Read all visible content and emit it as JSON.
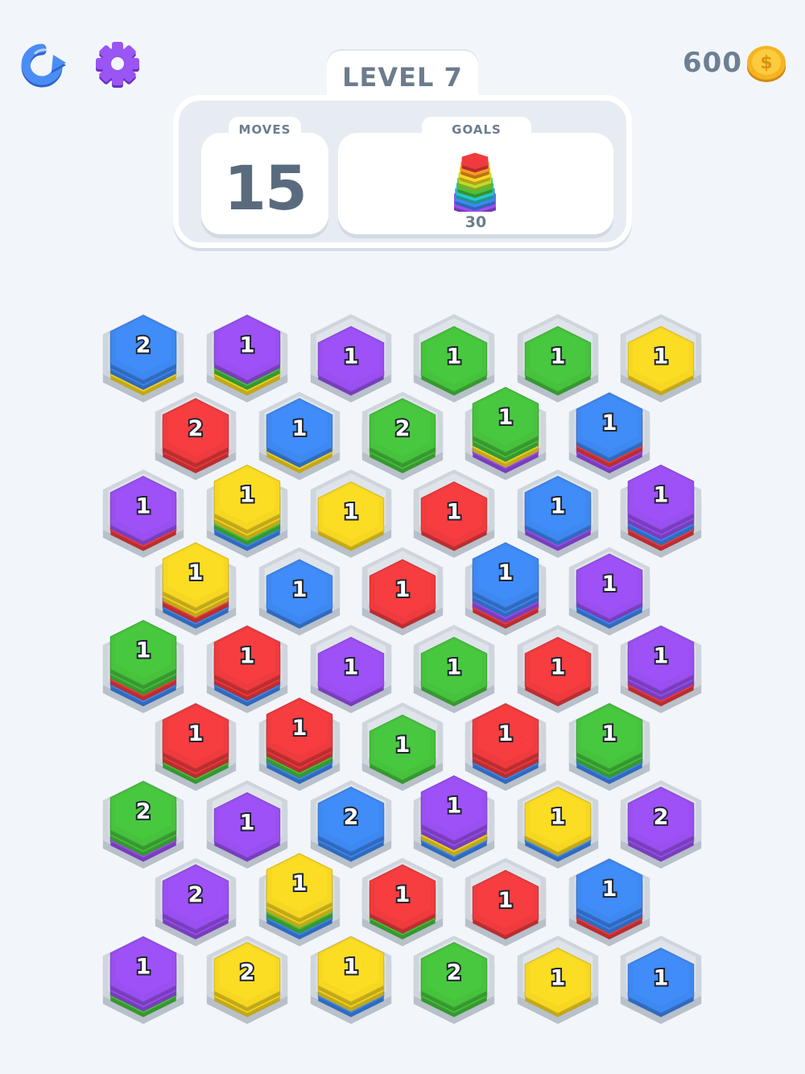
{
  "header": {
    "level_label": "LEVEL 7",
    "coins": "600",
    "restart_icon": "restart-icon",
    "settings_icon": "gear-icon",
    "coin_icon": "coin-icon"
  },
  "moves": {
    "label": "MOVES",
    "value": "15"
  },
  "goals": {
    "label": "GOALS",
    "value": "30",
    "icon": "rainbow-stack-icon"
  },
  "colors": {
    "blue": "#3e88f2",
    "purple": "#9a4ff0",
    "green": "#46c23d",
    "yellow": "#f7d722",
    "red": "#ef3b3e",
    "slot": "#cfd5dd",
    "background": "#f2f6fb"
  },
  "board": {
    "rows": [
      [
        {
          "count": "2",
          "layers": [
            "yellow",
            "blue",
            "blue"
          ]
        },
        {
          "count": "1",
          "layers": [
            "yellow",
            "green",
            "purple"
          ]
        },
        {
          "count": "1",
          "layers": [
            "purple"
          ]
        },
        {
          "count": "1",
          "layers": [
            "green"
          ]
        },
        {
          "count": "1",
          "layers": [
            "green"
          ]
        },
        {
          "count": "1",
          "layers": [
            "yellow"
          ]
        }
      ],
      [
        {
          "count": "2",
          "layers": [
            "red",
            "red"
          ]
        },
        {
          "count": "1",
          "layers": [
            "yellow",
            "blue"
          ]
        },
        {
          "count": "2",
          "layers": [
            "green",
            "green"
          ]
        },
        {
          "count": "1",
          "layers": [
            "purple",
            "yellow",
            "green",
            "green"
          ]
        },
        {
          "count": "1",
          "layers": [
            "purple",
            "red",
            "blue"
          ]
        }
      ],
      [
        {
          "count": "1",
          "layers": [
            "red",
            "purple"
          ]
        },
        {
          "count": "1",
          "layers": [
            "blue",
            "green",
            "yellow",
            "yellow"
          ]
        },
        {
          "count": "1",
          "layers": [
            "yellow"
          ]
        },
        {
          "count": "1",
          "layers": [
            "red"
          ]
        },
        {
          "count": "1",
          "layers": [
            "purple",
            "blue"
          ]
        },
        {
          "count": "1",
          "layers": [
            "red",
            "blue",
            "purple",
            "purple"
          ]
        }
      ],
      [
        {
          "count": "1",
          "layers": [
            "blue",
            "red",
            "yellow",
            "yellow"
          ]
        },
        {
          "count": "1",
          "layers": [
            "blue"
          ]
        },
        {
          "count": "1",
          "layers": [
            "red"
          ]
        },
        {
          "count": "1",
          "layers": [
            "red",
            "purple",
            "blue",
            "blue"
          ]
        },
        {
          "count": "1",
          "layers": [
            "blue",
            "purple"
          ]
        }
      ],
      [
        {
          "count": "1",
          "layers": [
            "blue",
            "red",
            "green",
            "green"
          ]
        },
        {
          "count": "1",
          "layers": [
            "blue",
            "red",
            "red"
          ]
        },
        {
          "count": "1",
          "layers": [
            "purple"
          ]
        },
        {
          "count": "1",
          "layers": [
            "green"
          ]
        },
        {
          "count": "1",
          "layers": [
            "red"
          ]
        },
        {
          "count": "1",
          "layers": [
            "red",
            "purple",
            "purple"
          ]
        }
      ],
      [
        {
          "count": "1",
          "layers": [
            "green",
            "red",
            "red"
          ]
        },
        {
          "count": "1",
          "layers": [
            "blue",
            "green",
            "red",
            "red"
          ]
        },
        {
          "count": "1",
          "layers": [
            "green"
          ]
        },
        {
          "count": "1",
          "layers": [
            "blue",
            "red",
            "red"
          ]
        },
        {
          "count": "1",
          "layers": [
            "blue",
            "green",
            "green"
          ]
        }
      ],
      [
        {
          "count": "2",
          "layers": [
            "purple",
            "green",
            "green"
          ]
        },
        {
          "count": "1",
          "layers": [
            "purple"
          ]
        },
        {
          "count": "2",
          "layers": [
            "blue",
            "blue"
          ]
        },
        {
          "count": "1",
          "layers": [
            "blue",
            "yellow",
            "purple",
            "purple"
          ]
        },
        {
          "count": "1",
          "layers": [
            "blue",
            "yellow"
          ]
        },
        {
          "count": "2",
          "layers": [
            "purple",
            "purple"
          ]
        }
      ],
      [
        {
          "count": "2",
          "layers": [
            "purple",
            "purple"
          ]
        },
        {
          "count": "1",
          "layers": [
            "blue",
            "green",
            "yellow",
            "yellow"
          ]
        },
        {
          "count": "1",
          "layers": [
            "green",
            "red"
          ]
        },
        {
          "count": "1",
          "layers": [
            "red"
          ]
        },
        {
          "count": "1",
          "layers": [
            "red",
            "blue",
            "blue"
          ]
        }
      ],
      [
        {
          "count": "1",
          "layers": [
            "green",
            "purple",
            "purple"
          ]
        },
        {
          "count": "2",
          "layers": [
            "yellow",
            "yellow"
          ]
        },
        {
          "count": "1",
          "layers": [
            "blue",
            "yellow",
            "yellow"
          ]
        },
        {
          "count": "2",
          "layers": [
            "green",
            "green"
          ]
        },
        {
          "count": "1",
          "layers": [
            "yellow"
          ]
        },
        {
          "count": "1",
          "layers": [
            "blue"
          ]
        }
      ]
    ]
  }
}
